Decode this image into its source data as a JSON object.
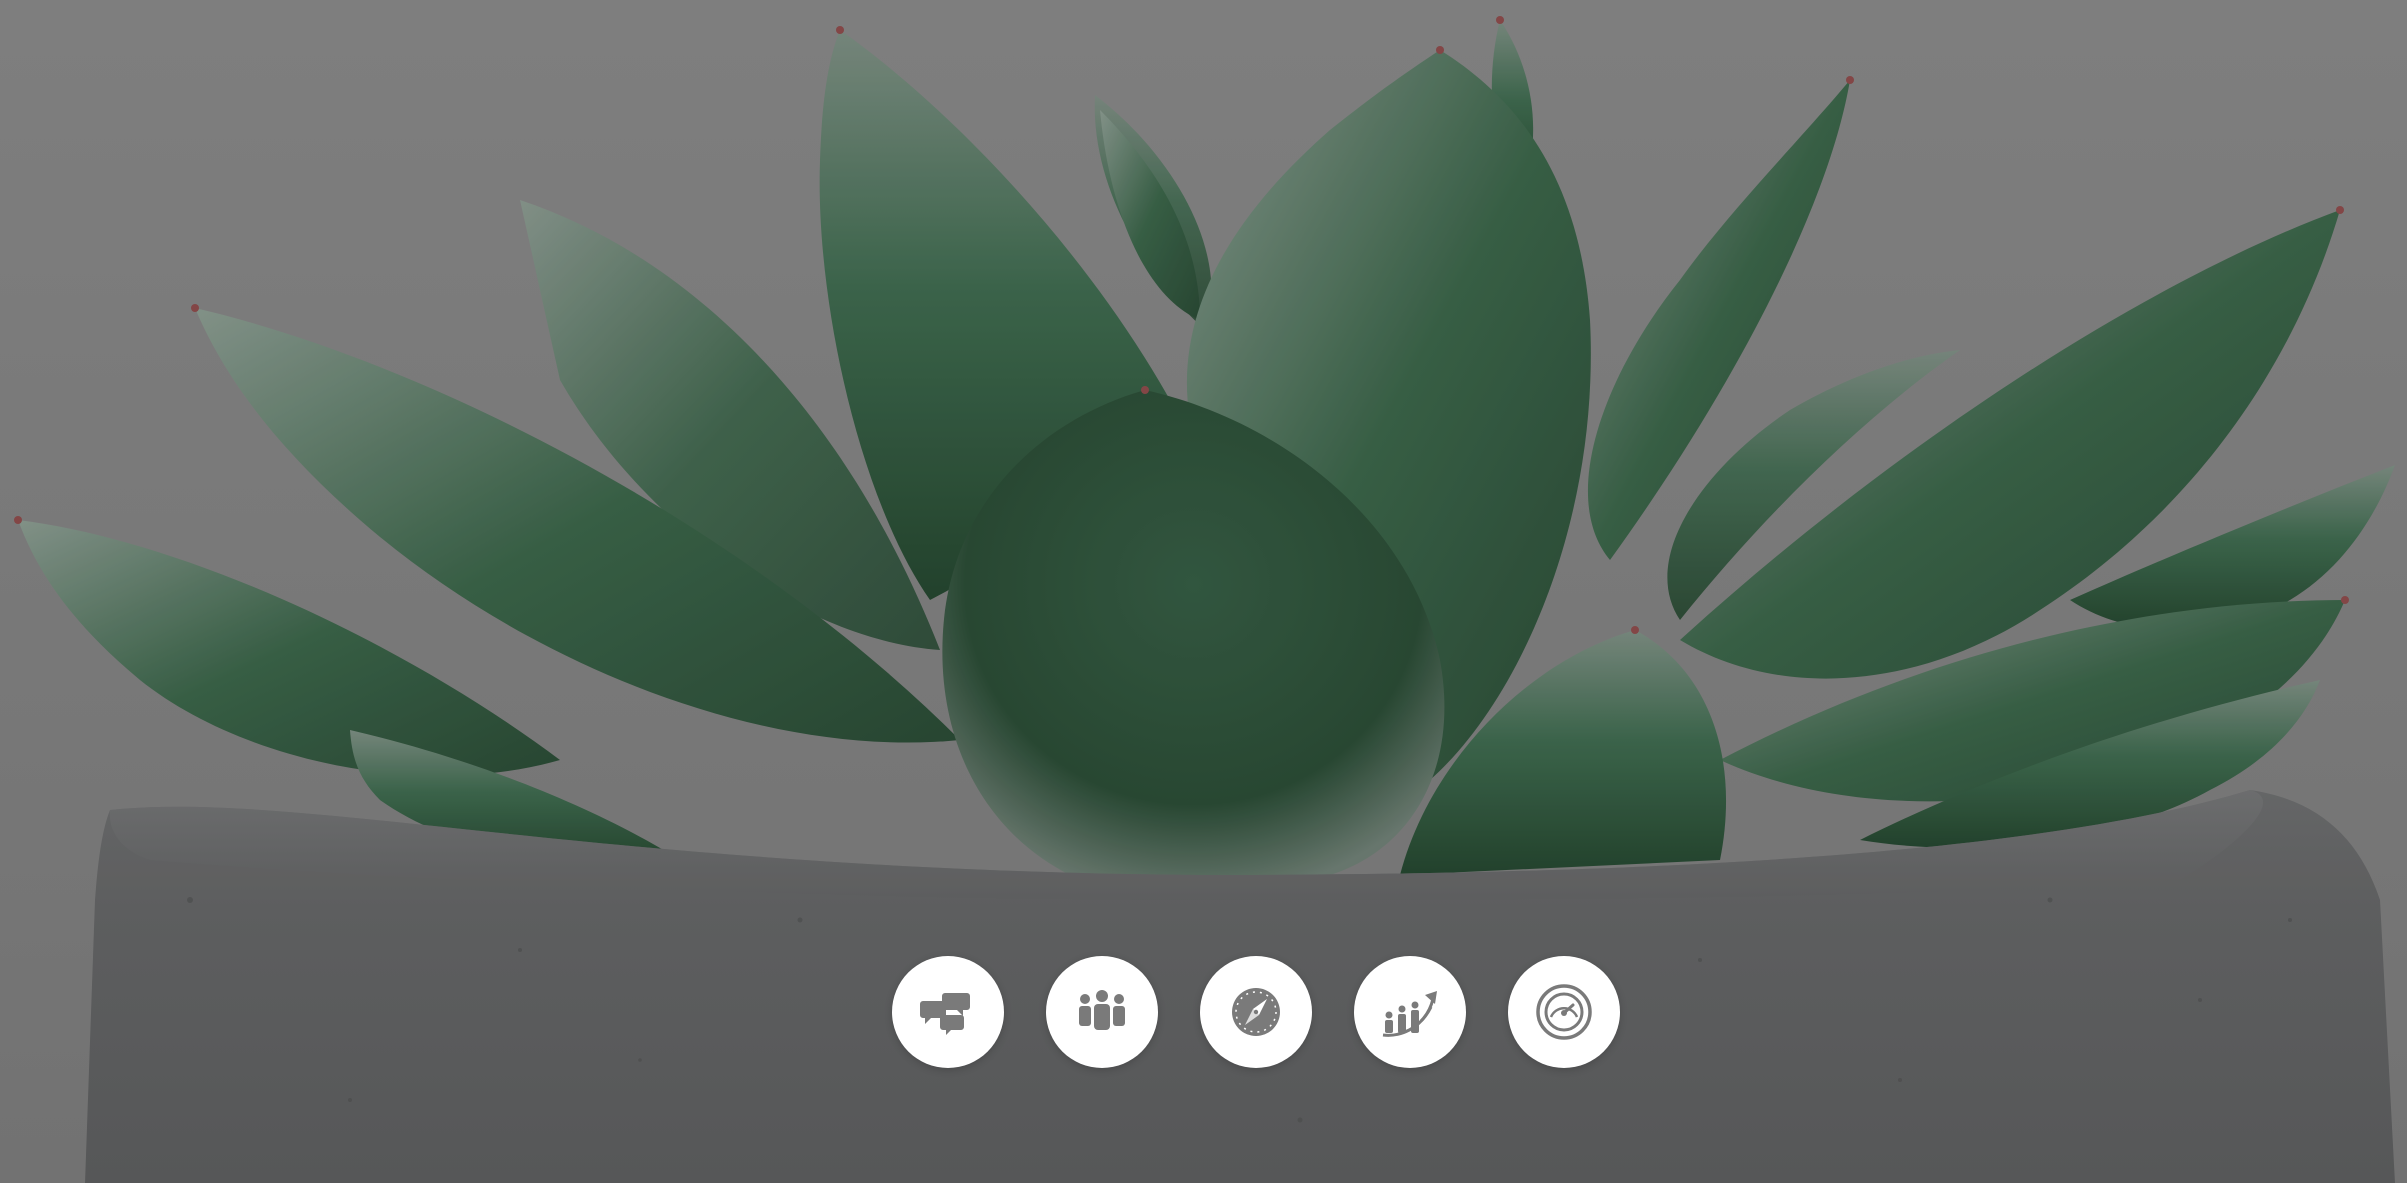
{
  "page": {
    "background": "succulent-in-concrete-pot-photo"
  },
  "colors": {
    "icon_background": "#ffffff",
    "icon_glyph": "#7a7a7a",
    "overlay_gray": "#808080",
    "leaf_green": "#2f5a40"
  },
  "icon_row": {
    "items": [
      {
        "icon": "chat-bubbles-icon"
      },
      {
        "icon": "team-people-icon"
      },
      {
        "icon": "compass-icon"
      },
      {
        "icon": "growth-chart-icon"
      },
      {
        "icon": "speedometer-icon"
      }
    ]
  }
}
